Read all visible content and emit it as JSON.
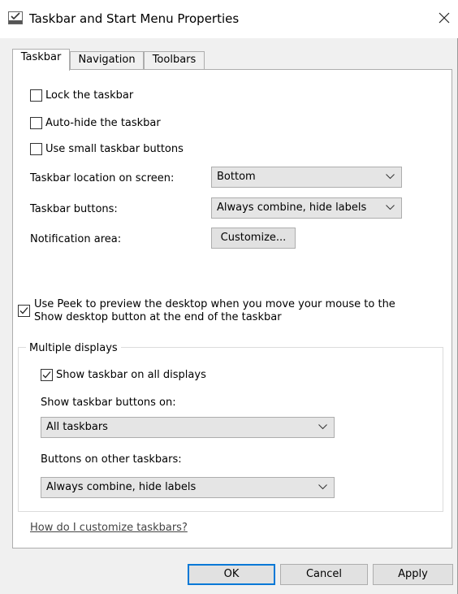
{
  "window": {
    "title": "Taskbar and Start Menu Properties"
  },
  "tabs": [
    {
      "label": "Taskbar",
      "active": true
    },
    {
      "label": "Navigation",
      "active": false
    },
    {
      "label": "Toolbars",
      "active": false
    }
  ],
  "taskbar": {
    "lock": {
      "label": "Lock the taskbar",
      "checked": false
    },
    "autohide": {
      "label": "Auto-hide the taskbar",
      "checked": false
    },
    "small_buttons": {
      "label": "Use small taskbar buttons",
      "checked": false
    },
    "location": {
      "label": "Taskbar location on screen:",
      "value": "Bottom"
    },
    "buttons": {
      "label": "Taskbar buttons:",
      "value": "Always combine, hide labels"
    },
    "notification": {
      "label": "Notification area:",
      "button": "Customize..."
    },
    "peek": {
      "line1": "Use Peek to preview the desktop when you move your mouse to the",
      "line2": "Show desktop button at the end of the taskbar",
      "checked": true
    }
  },
  "multiple_displays": {
    "title": "Multiple displays",
    "show_all": {
      "label": "Show taskbar on all displays",
      "checked": true
    },
    "show_on_label": "Show taskbar buttons on:",
    "show_on_value": "All taskbars",
    "other_label": "Buttons on other taskbars:",
    "other_value": "Always combine, hide labels"
  },
  "help_link": "How do I customize taskbars?",
  "footer": {
    "ok": "OK",
    "cancel": "Cancel",
    "apply": "Apply"
  },
  "colors": {
    "accent": "#0078d7",
    "panel": "#ffffff",
    "window": "#f0f0f0"
  }
}
